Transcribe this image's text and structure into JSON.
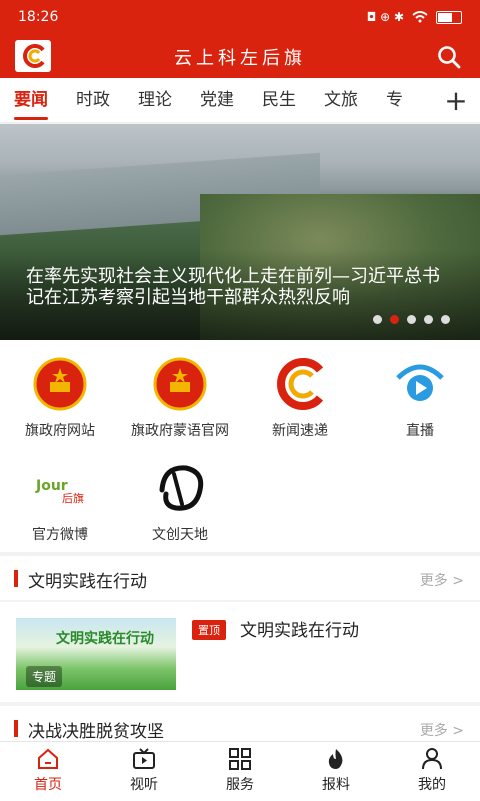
{
  "status": {
    "time": "18:26",
    "extra": "◘ ⊕ ✱"
  },
  "header": {
    "title": "云上科左后旗"
  },
  "tabs": [
    "要闻",
    "时政",
    "理论",
    "党建",
    "民生",
    "文旅",
    "专"
  ],
  "banner": {
    "caption": "在率先实现社会主义现代化上走在前列—习近平总书记在江苏考察引起当地干部群众热烈反响",
    "dot_count": 5,
    "active_dot": 1
  },
  "grid": [
    {
      "label": "旗政府网站",
      "icon": "emblem-icon"
    },
    {
      "label": "旗政府蒙语官网",
      "icon": "emblem-icon"
    },
    {
      "label": "新闻速递",
      "icon": "news-logo-icon"
    },
    {
      "label": "直播",
      "icon": "live-icon"
    },
    {
      "label": "官方微博",
      "icon": "weibo-logo-icon"
    },
    {
      "label": "文创天地",
      "icon": "calligraphy-icon"
    }
  ],
  "sections": [
    {
      "title": "文明实践在行动",
      "more": "更多 >"
    },
    {
      "title": "决战决胜脱贫攻坚",
      "more": "更多 >"
    }
  ],
  "card": {
    "thumb_title": "文明实践在行动",
    "thumb_tag": "专题",
    "pin": "置顶",
    "title": "文明实践在行动"
  },
  "bottom_nav": [
    "首页",
    "视听",
    "服务",
    "报料",
    "我的"
  ],
  "colors": {
    "accent": "#d9230f"
  }
}
